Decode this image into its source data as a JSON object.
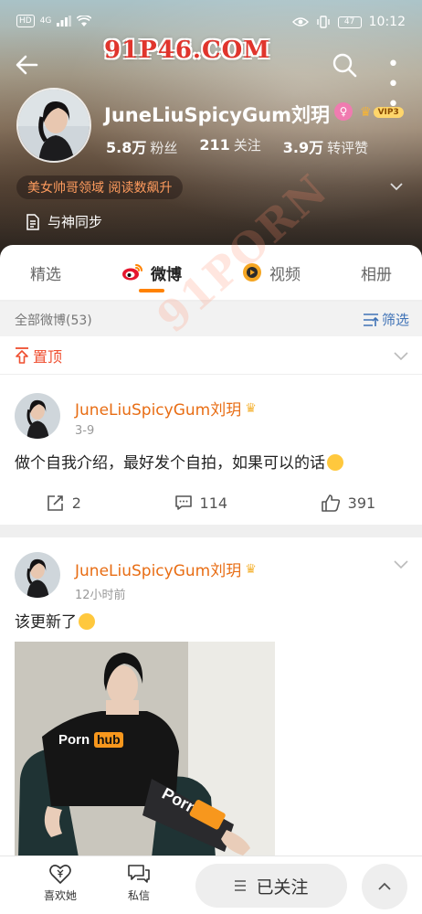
{
  "status_bar": {
    "network": "HD",
    "signal_tag": "4G",
    "battery": "47",
    "time": "10:12"
  },
  "watermark": "91P46.COM",
  "diagonal_watermark": "91PORN",
  "profile": {
    "name": "JuneLiuSpicyGum刘玥",
    "vip_label": "VIP3",
    "stats": [
      {
        "num": "5.8万",
        "label": "粉丝"
      },
      {
        "num": "211",
        "label": "关注"
      },
      {
        "num": "3.9万",
        "label": "转评赞"
      }
    ],
    "tag": "美女帅哥领域 阅读数飙升",
    "sync_text": "与神同步"
  },
  "tabs": [
    {
      "label": "精选",
      "active": false
    },
    {
      "label": "微博",
      "active": true
    },
    {
      "label": "视频",
      "active": false
    },
    {
      "label": "相册",
      "active": false
    }
  ],
  "filter": {
    "count_label": "全部微博(53)",
    "filter_label": "筛选"
  },
  "pinned_label": "置顶",
  "posts": [
    {
      "author": "JuneLiuSpicyGum刘玥",
      "time": "3-9",
      "text": "做个自我介绍，最好发个自拍，如果可以的话",
      "repost_count": "2",
      "comment_count": "114",
      "like_count": "391"
    },
    {
      "author": "JuneLiuSpicyGum刘玥",
      "time": "12小时前",
      "text": "该更新了",
      "image_caption": "Porn hub"
    }
  ],
  "bottom_bar": {
    "like_label": "喜欢她",
    "message_label": "私信",
    "follow_label": "已关注"
  },
  "colors": {
    "accent_orange": "#ff8200",
    "author_orange": "#e86d14",
    "pinned_red": "#ef4e2f",
    "link_blue": "#3f72b6"
  }
}
